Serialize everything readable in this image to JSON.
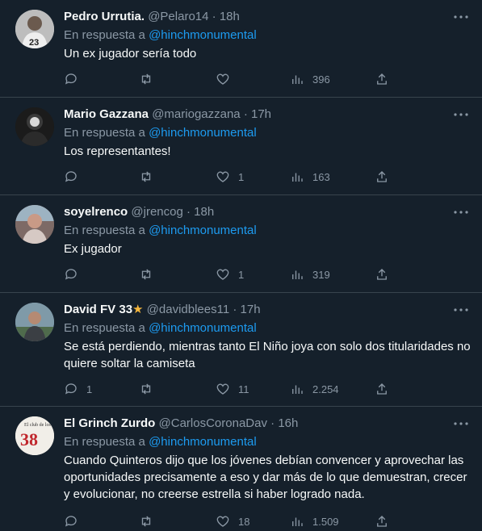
{
  "tweets": [
    {
      "name": "Pedro Urrutia.",
      "handle": "@Pelaro14",
      "time": "18h",
      "reply_prefix": "En respuesta a",
      "reply_to": "@hinchmonumental",
      "text": "Un ex jugador sería todo",
      "replies": "",
      "retweets": "",
      "likes": "",
      "views": "396"
    },
    {
      "name": "Mario Gazzana",
      "handle": "@mariogazzana",
      "time": "17h",
      "reply_prefix": "En respuesta a",
      "reply_to": "@hinchmonumental",
      "text": "Los representantes!",
      "replies": "",
      "retweets": "",
      "likes": "1",
      "views": "163"
    },
    {
      "name": "soyelrenco",
      "handle": "@jrencog",
      "time": "18h",
      "reply_prefix": "En respuesta a",
      "reply_to": "@hinchmonumental",
      "text": "Ex jugador",
      "replies": "",
      "retweets": "",
      "likes": "1",
      "views": "319"
    },
    {
      "name": "David FV 33",
      "name_emoji": "★",
      "handle": "@davidblees11",
      "time": "17h",
      "reply_prefix": "En respuesta a",
      "reply_to": "@hinchmonumental",
      "text": "Se está perdiendo, mientras tanto El Niño joya con solo dos titularidades no quiere soltar la camiseta",
      "replies": "1",
      "retweets": "",
      "likes": "11",
      "views": "2.254"
    },
    {
      "name": "El Grinch Zurdo",
      "handle": "@CarlosCoronaDav",
      "time": "16h",
      "reply_prefix": "En respuesta a",
      "reply_to": "@hinchmonumental",
      "text": "Cuando Quinteros dijo que los jóvenes debían convencer y aprovechar las oportunidades precisamente a eso y dar más de lo que demuestran, crecer y evolucionar, no creerse estrella si  haber logrado nada.",
      "replies": "",
      "retweets": "",
      "likes": "18",
      "views": "1.509"
    }
  ],
  "dot_separator": "·",
  "avatar5_text": {
    "main": "38",
    "small": "El club de los"
  }
}
